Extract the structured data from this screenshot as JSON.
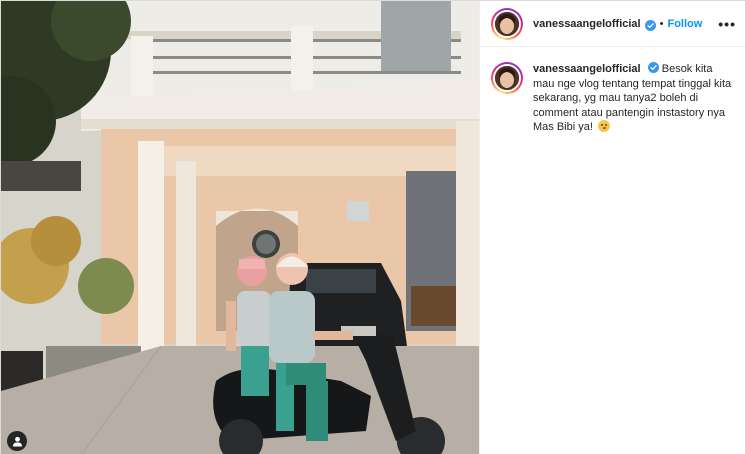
{
  "post": {
    "author": {
      "username": "vanessaangelofficial",
      "verified": true,
      "follow_label": "Follow",
      "separator": "•",
      "more_label": "•••"
    },
    "caption": {
      "username": "vanessaangelofficial",
      "text": "Besok kita mau nge vlog tentang tempat tinggal kita sekarang, yg mau tanya2 boleh di comment atau pantengin instastory nya Mas Bibi ya!",
      "emoji": "winking-kiss-emoji"
    },
    "media": {
      "tagged_users_icon": "user-tag-icon"
    }
  },
  "colors": {
    "link_blue": "#0095f6",
    "verified_blue": "#3897f0",
    "text": "#262626",
    "border": "#dbdbdb"
  }
}
